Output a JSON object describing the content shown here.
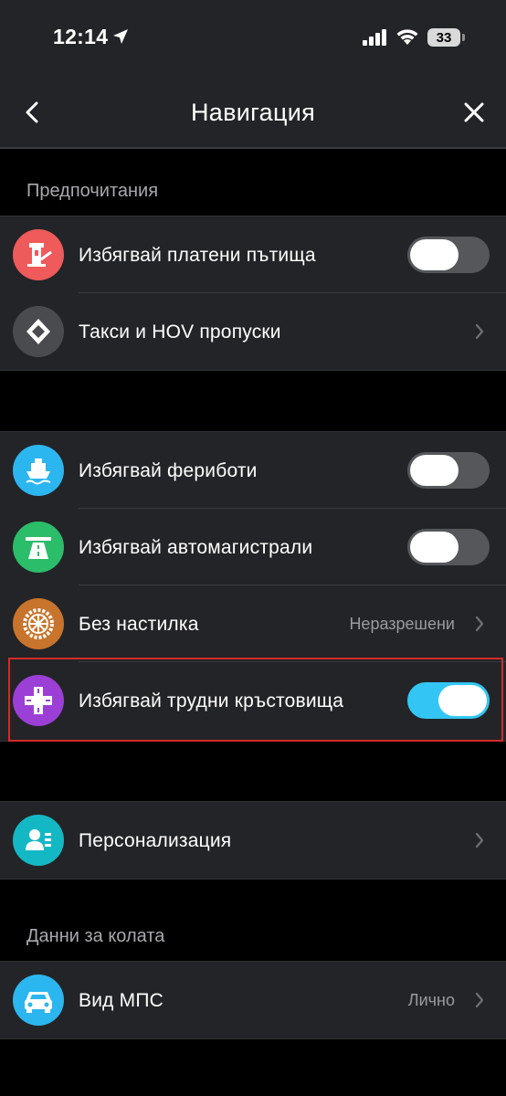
{
  "status_bar": {
    "time": "12:14",
    "battery": "33"
  },
  "header": {
    "title": "Навигация",
    "back_icon": "chevron-left-icon",
    "close_icon": "close-icon"
  },
  "sections": {
    "preferences_label": "Предпочитания",
    "car_data_label": "Данни за колата"
  },
  "group1": [
    {
      "label": "Избягвай платени пътища",
      "icon": "toll-booth-icon",
      "color": "#ef5a5a",
      "control": "toggle",
      "on": false
    },
    {
      "label": "Такси и HOV пропуски",
      "icon": "diamond-lane-icon",
      "color": "#4a4b4f",
      "control": "chevron"
    }
  ],
  "group2": [
    {
      "label": "Избягвай фериботи",
      "icon": "ferry-icon",
      "color": "#2cb6f0",
      "control": "toggle",
      "on": false
    },
    {
      "label": "Избягвай автомагистрали",
      "icon": "highway-icon",
      "color": "#2bbd6a",
      "control": "toggle",
      "on": false
    },
    {
      "label": "Без настилка",
      "icon": "wheel-icon",
      "color": "#c8742c",
      "value": "Неразрешени",
      "control": "chevron"
    },
    {
      "label": "Избягвай трудни кръстовища",
      "icon": "intersection-icon",
      "color": "#9b3fd6",
      "control": "toggle",
      "on": true
    }
  ],
  "group3": [
    {
      "label": "Персонализация",
      "icon": "profile-card-icon",
      "color": "#14b8c4",
      "control": "chevron"
    }
  ],
  "group4": [
    {
      "label": "Вид МПС",
      "icon": "car-icon",
      "color": "#2cb6f0",
      "value": "Лично",
      "control": "chevron"
    }
  ],
  "colors": {
    "background": "#000000",
    "surface": "#232427",
    "toggle_on": "#33c6f4",
    "toggle_off": "#56575b",
    "highlight": "#d42a2a"
  }
}
